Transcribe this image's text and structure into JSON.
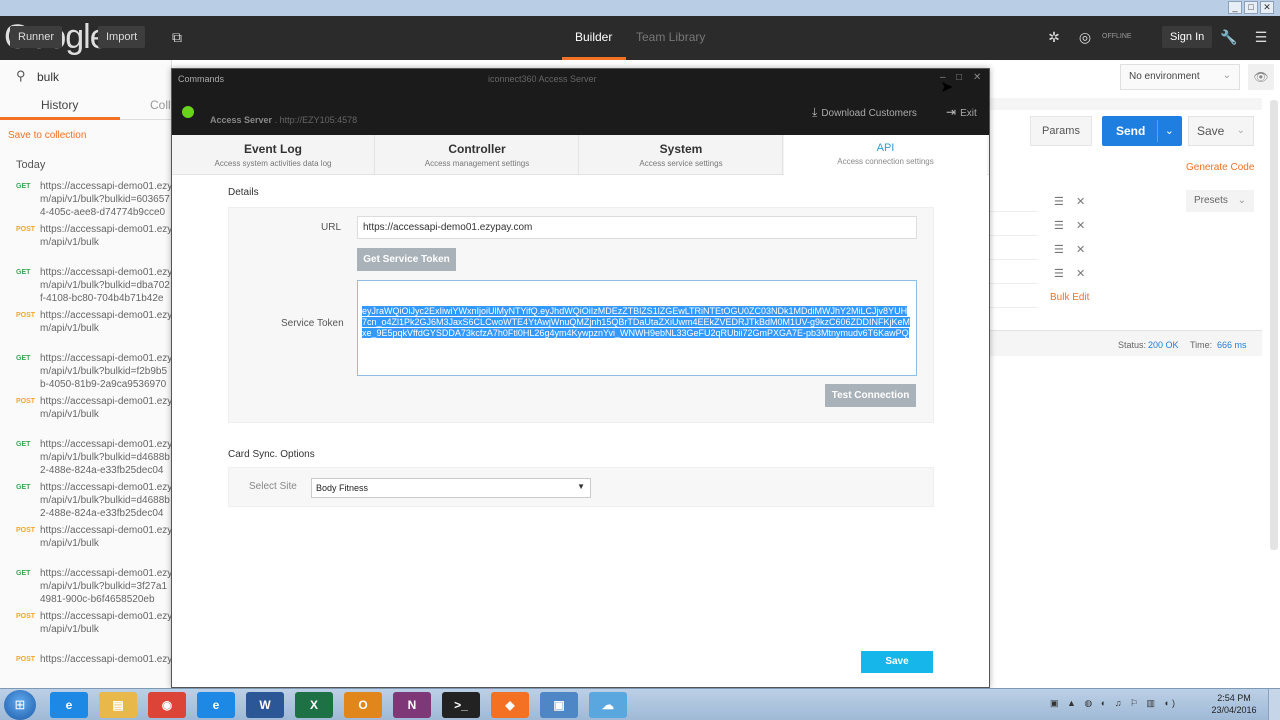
{
  "postman": {
    "logo_text": "Google",
    "header_buttons": [
      "Runner",
      "Import"
    ],
    "tabs": [
      "Builder",
      "Team Library"
    ],
    "offline_label": "OFFLINE",
    "sign_in": "Sign In",
    "search_value": "bulk",
    "left_tabs": [
      "History",
      "Coll"
    ],
    "save_to_collection": "Save to collection",
    "today": "Today",
    "history": [
      {
        "method": "GET",
        "url": "https://accessapi-demo01.ezy\nm/api/v1/bulk?bulkid=603657\n4-405c-aee8-d74774b9cce0"
      },
      {
        "method": "POST",
        "url": "https://accessapi-demo01.ezy\nm/api/v1/bulk"
      },
      {
        "method": "GET",
        "url": "https://accessapi-demo01.ezy\nm/api/v1/bulk?bulkid=dba702\nf-4108-bc80-704b4b71b42e"
      },
      {
        "method": "POST",
        "url": "https://accessapi-demo01.ezy\nm/api/v1/bulk"
      },
      {
        "method": "GET",
        "url": "https://accessapi-demo01.ezy\nm/api/v1/bulk?bulkid=f2b9b5\nb-4050-81b9-2a9ca9536970"
      },
      {
        "method": "POST",
        "url": "https://accessapi-demo01.ezy\nm/api/v1/bulk"
      },
      {
        "method": "GET",
        "url": "https://accessapi-demo01.ezy\nm/api/v1/bulk?bulkid=d4688b\n2-488e-824a-e33fb25dec04"
      },
      {
        "method": "GET",
        "url": "https://accessapi-demo01.ezy\nm/api/v1/bulk?bulkid=d4688b\n2-488e-824a-e33fb25dec04"
      },
      {
        "method": "POST",
        "url": "https://accessapi-demo01.ezy\nm/api/v1/bulk"
      },
      {
        "method": "GET",
        "url": "https://accessapi-demo01.ezy\nm/api/v1/bulk?bulkid=3f27a1\n4981-900c-b6f4658520eb"
      },
      {
        "method": "POST",
        "url": "https://accessapi-demo01.ezy\nm/api/v1/bulk"
      },
      {
        "method": "POST",
        "url": "https://accessapi-demo01.ezy"
      }
    ],
    "environment": "No environment",
    "params": "Params",
    "send": "Send",
    "save": "Save",
    "generate_code": "Generate Code",
    "presets": "Presets",
    "bulk_edit": "Bulk Edit",
    "status_label": "Status:",
    "status_value": "200 OK",
    "time_label": "Time:",
    "time_value": "666 ms"
  },
  "dialog": {
    "commands": "Commands",
    "window_title": "iconnect360 Access Server",
    "server_label": "Access Server",
    "server_url": "http://EZY105:4578",
    "download_customers": "Download Customers",
    "exit": "Exit",
    "tabs": [
      {
        "title": "Event Log",
        "sub": "Access system activities data log"
      },
      {
        "title": "Controller",
        "sub": "Access management settings"
      },
      {
        "title": "System",
        "sub": "Access service settings"
      },
      {
        "title": "API",
        "sub": "Access connection settings"
      }
    ],
    "details_label": "Details",
    "url_label": "URL",
    "url_value": "https://accessapi-demo01.ezypay.com",
    "get_service_token": "Get Service Token",
    "service_token_label": "Service Token",
    "service_token_value": "eyJraWQiOiJyc2ExIiwiYWxnIjoiUlMyNTYifQ.eyJhdWQiOiIzMDEzZTBlZS1lZGEwLTRiNTEtOGU0ZC03NDk1MDdiMWJhY2MiLCJjv8YUH7cn_o4Zl1Pk2GJ6M3JaxS6CLCwoWTE4YtAwjWnuQMZjnh15QBrTDaUtaZXiUwm4EEkZVEDRJTkBdM0M1UV-g9kzC606ZDDINFKjKeMxe_9E5pqkVffdGYSDDA73kcfzA7h0Ftl0HL26g4ym4KywpznYvi_WNWH9ebNL33GeFU2qRUbii72GmPXGA7E-pb3Mtnymudv6T6KawPQ",
    "test_connection": "Test Connection",
    "card_sync_label": "Card Sync. Options",
    "select_site_label": "Select Site",
    "select_site_value": "Body Fitness",
    "save_button": "Save"
  },
  "taskbar": {
    "apps": [
      {
        "name": "ie",
        "label": "e",
        "color": "#1e88e5"
      },
      {
        "name": "explorer",
        "label": "▤",
        "color": "#e8b84a"
      },
      {
        "name": "chrome",
        "label": "◉",
        "color": "#db4437"
      },
      {
        "name": "ie2",
        "label": "e",
        "color": "#1e88e5"
      },
      {
        "name": "word",
        "label": "W",
        "color": "#2b5797"
      },
      {
        "name": "excel",
        "label": "X",
        "color": "#1e7145"
      },
      {
        "name": "outlook",
        "label": "O",
        "color": "#e0861a"
      },
      {
        "name": "onenote",
        "label": "N",
        "color": "#7e3878"
      },
      {
        "name": "cmd",
        "label": ">_",
        "color": "#222222"
      },
      {
        "name": "postman",
        "label": "◆",
        "color": "#f47023"
      },
      {
        "name": "app",
        "label": "▣",
        "color": "#4f86c6"
      },
      {
        "name": "cloud",
        "label": "☁",
        "color": "#5aa7e0"
      }
    ],
    "time": "2:54 PM",
    "date": "23/04/2016"
  }
}
